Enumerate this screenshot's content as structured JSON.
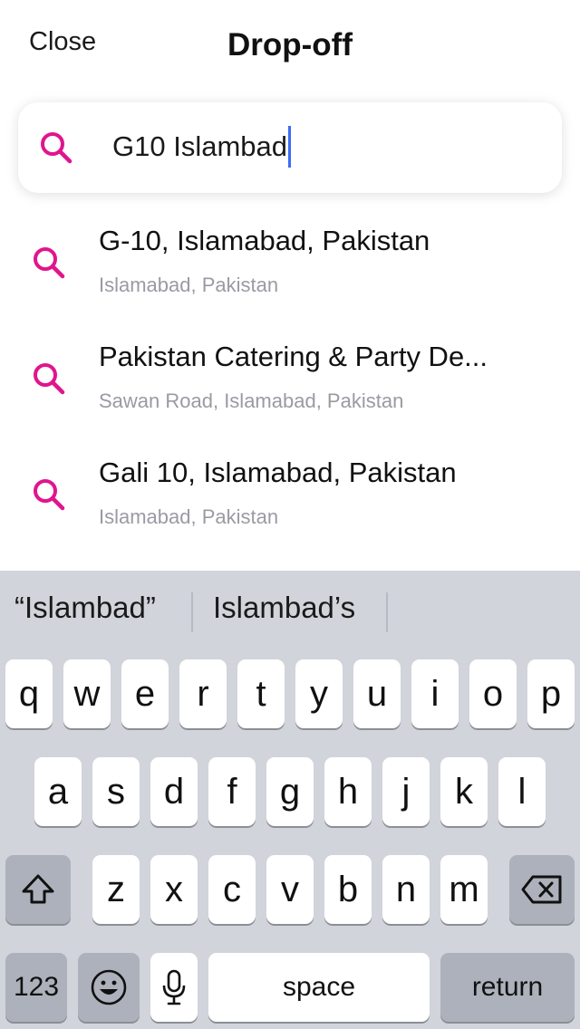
{
  "header": {
    "close_label": "Close",
    "title": "Drop-off"
  },
  "search": {
    "value": "G10 Islambad",
    "icon": "search-icon"
  },
  "colors": {
    "accent": "#e0158e",
    "caret": "#3a6cf5",
    "keyboard_bg": "#d1d4db"
  },
  "results": [
    {
      "title": "G-10, Islamabad, Pakistan",
      "subtitle": "Islamabad, Pakistan"
    },
    {
      "title": "Pakistan Catering & Party De...",
      "subtitle": "Sawan Road, Islamabad, Pakistan"
    },
    {
      "title": "Gali 10, Islamabad, Pakistan",
      "subtitle": "Islamabad, Pakistan"
    }
  ],
  "keyboard": {
    "suggestions": [
      "“Islambad”",
      "Islambad’s"
    ],
    "row1": [
      "q",
      "w",
      "e",
      "r",
      "t",
      "y",
      "u",
      "i",
      "o",
      "p"
    ],
    "row2": [
      "a",
      "s",
      "d",
      "f",
      "g",
      "h",
      "j",
      "k",
      "l"
    ],
    "row3": [
      "z",
      "x",
      "c",
      "v",
      "b",
      "n",
      "m"
    ],
    "numbers_label": "123",
    "space_label": "space",
    "return_label": "return"
  }
}
